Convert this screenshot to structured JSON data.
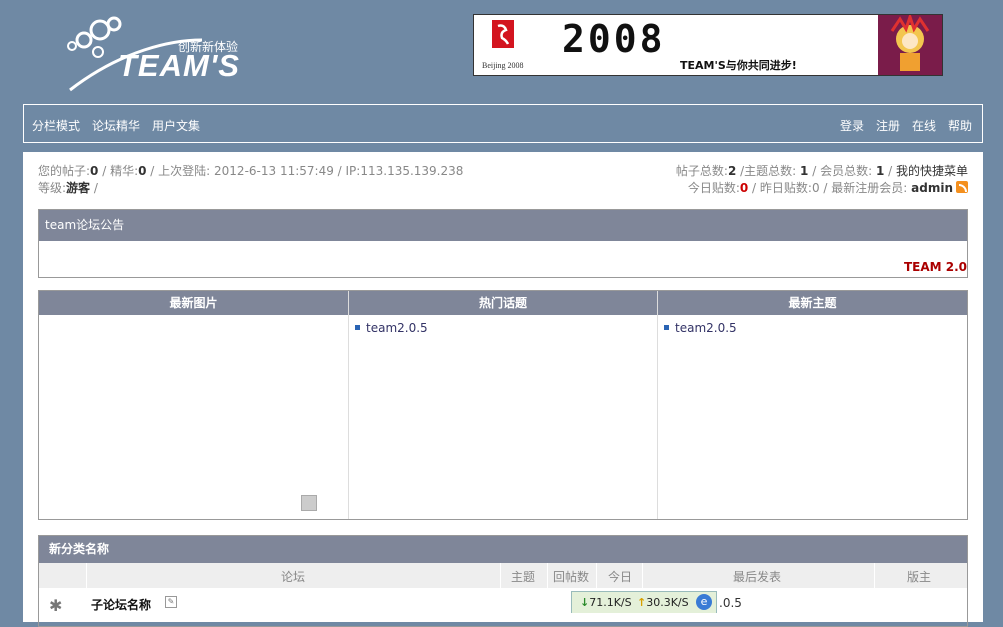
{
  "header": {
    "logo_text": "TEAM'S",
    "slogan": "创新新体验",
    "banner": {
      "year": "2008",
      "slogan": "TEAM'S与你共同进步!",
      "beijing": "Beijing 2008"
    }
  },
  "nav": {
    "left": [
      "分栏模式",
      "论坛精华",
      "用户文集"
    ],
    "right": [
      "登录",
      "注册",
      "在线",
      "帮助"
    ]
  },
  "userinfo": {
    "posts_label": "您的帖子:",
    "posts": "0",
    "digest_label": "精华:",
    "digest": "0",
    "lastlogin_label": "上次登陆:",
    "lastlogin": "2012-6-13 11:57:49",
    "ip_label": "IP:",
    "ip": "113.135.139.238",
    "level_label": "等级:",
    "level": "游客"
  },
  "stats": {
    "total_posts_label": "帖子总数:",
    "total_posts": "2",
    "topics_label": "主题总数:",
    "topics": "1",
    "members_label": "会员总数:",
    "members": "1",
    "quick_menu": "我的快捷菜单",
    "today_label": "今日贴数:",
    "today": "0",
    "yesterday_label": "昨日贴数:",
    "yesterday": "0",
    "newest_label": "最新注册会员:",
    "newest": "admin"
  },
  "notice": {
    "title": "team论坛公告",
    "signature": "TEAM 2.0"
  },
  "panels": {
    "latest_images": "最新图片",
    "hot_topics": "热门话题",
    "latest_topics": "最新主题",
    "hot_items": [
      "team2.0.5"
    ],
    "latest_items": [
      "team2.0.5"
    ]
  },
  "category": {
    "name": "新分类名称",
    "columns": [
      "论坛",
      "主题",
      "回帖数",
      "今日",
      "最后发表",
      "版主"
    ],
    "rows": [
      {
        "name": "子论坛名称",
        "last": ".0.5"
      }
    ]
  },
  "taskbar": {
    "down": "71.1K/S",
    "up": "30.3K/S"
  }
}
